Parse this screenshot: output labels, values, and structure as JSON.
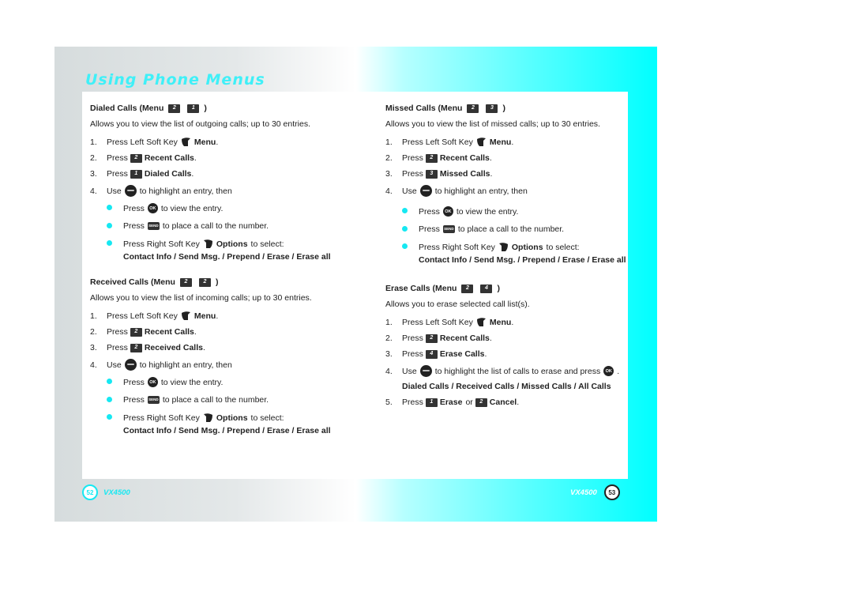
{
  "header": {
    "title": "Using Phone Menus"
  },
  "colors": {
    "accent": "#16e8f2",
    "title": "#3ff0f8",
    "frame_cyan": "#00ffff",
    "frame_gray": "#d6dcdd"
  },
  "icons": {
    "left_soft_key": "left-soft-key-icon",
    "right_soft_key": "right-soft-key-icon",
    "nav_key": "navigation-key-icon",
    "ok_key": "ok-key-icon",
    "send_key": "send-key-icon"
  },
  "keys": {
    "k1": "1",
    "k2": "2",
    "k3": "3",
    "k4": "4",
    "ok": "OK",
    "send": "SEND"
  },
  "common": {
    "menu_open": "Press Left Soft Key",
    "menu": "Menu",
    "press": "Press",
    "recent_calls": "Recent Calls",
    "use": "Use",
    "highlight_entry": "to highlight an entry, then",
    "view_entry": "to view the entry.",
    "place_call": "to place a call to the number.",
    "right_soft": "Press Right Soft Key",
    "options": "Options",
    "to_select": "to select:",
    "options_list": "Contact Info / Send Msg. / Prepend / Erase / Erase all",
    "period": "."
  },
  "sections": {
    "dialed": {
      "title": "Dialed Calls (Menu",
      "menu_keys": [
        "2",
        "1"
      ],
      "desc": "Allows you to view the list of outgoing calls; up to 30 entries.",
      "step3_label": "Dialed Calls"
    },
    "received": {
      "title": "Received Calls (Menu",
      "menu_keys": [
        "2",
        "2"
      ],
      "desc": "Allows you to view the list of incoming calls; up to 30 entries.",
      "step3_label": "Received Calls"
    },
    "missed": {
      "title": "Missed Calls (Menu",
      "menu_keys": [
        "2",
        "3"
      ],
      "desc": "Allows you to view the list of missed calls; up to 30 entries.",
      "step3_label": "Missed Calls"
    },
    "erase": {
      "title": "Erase Calls (Menu",
      "menu_keys": [
        "2",
        "4"
      ],
      "desc": "Allows you to erase selected call list(s).",
      "step3_label": "Erase Calls",
      "step4_text": "to highlight the list of calls to erase and press",
      "step4_options": "Dialed Calls / Received Calls / Missed Calls / All Calls",
      "step5_erase": "Erase",
      "step5_or": "or",
      "step5_cancel": "Cancel"
    }
  },
  "footer": {
    "left_page": "52",
    "right_page": "53",
    "model": "VX4500"
  }
}
